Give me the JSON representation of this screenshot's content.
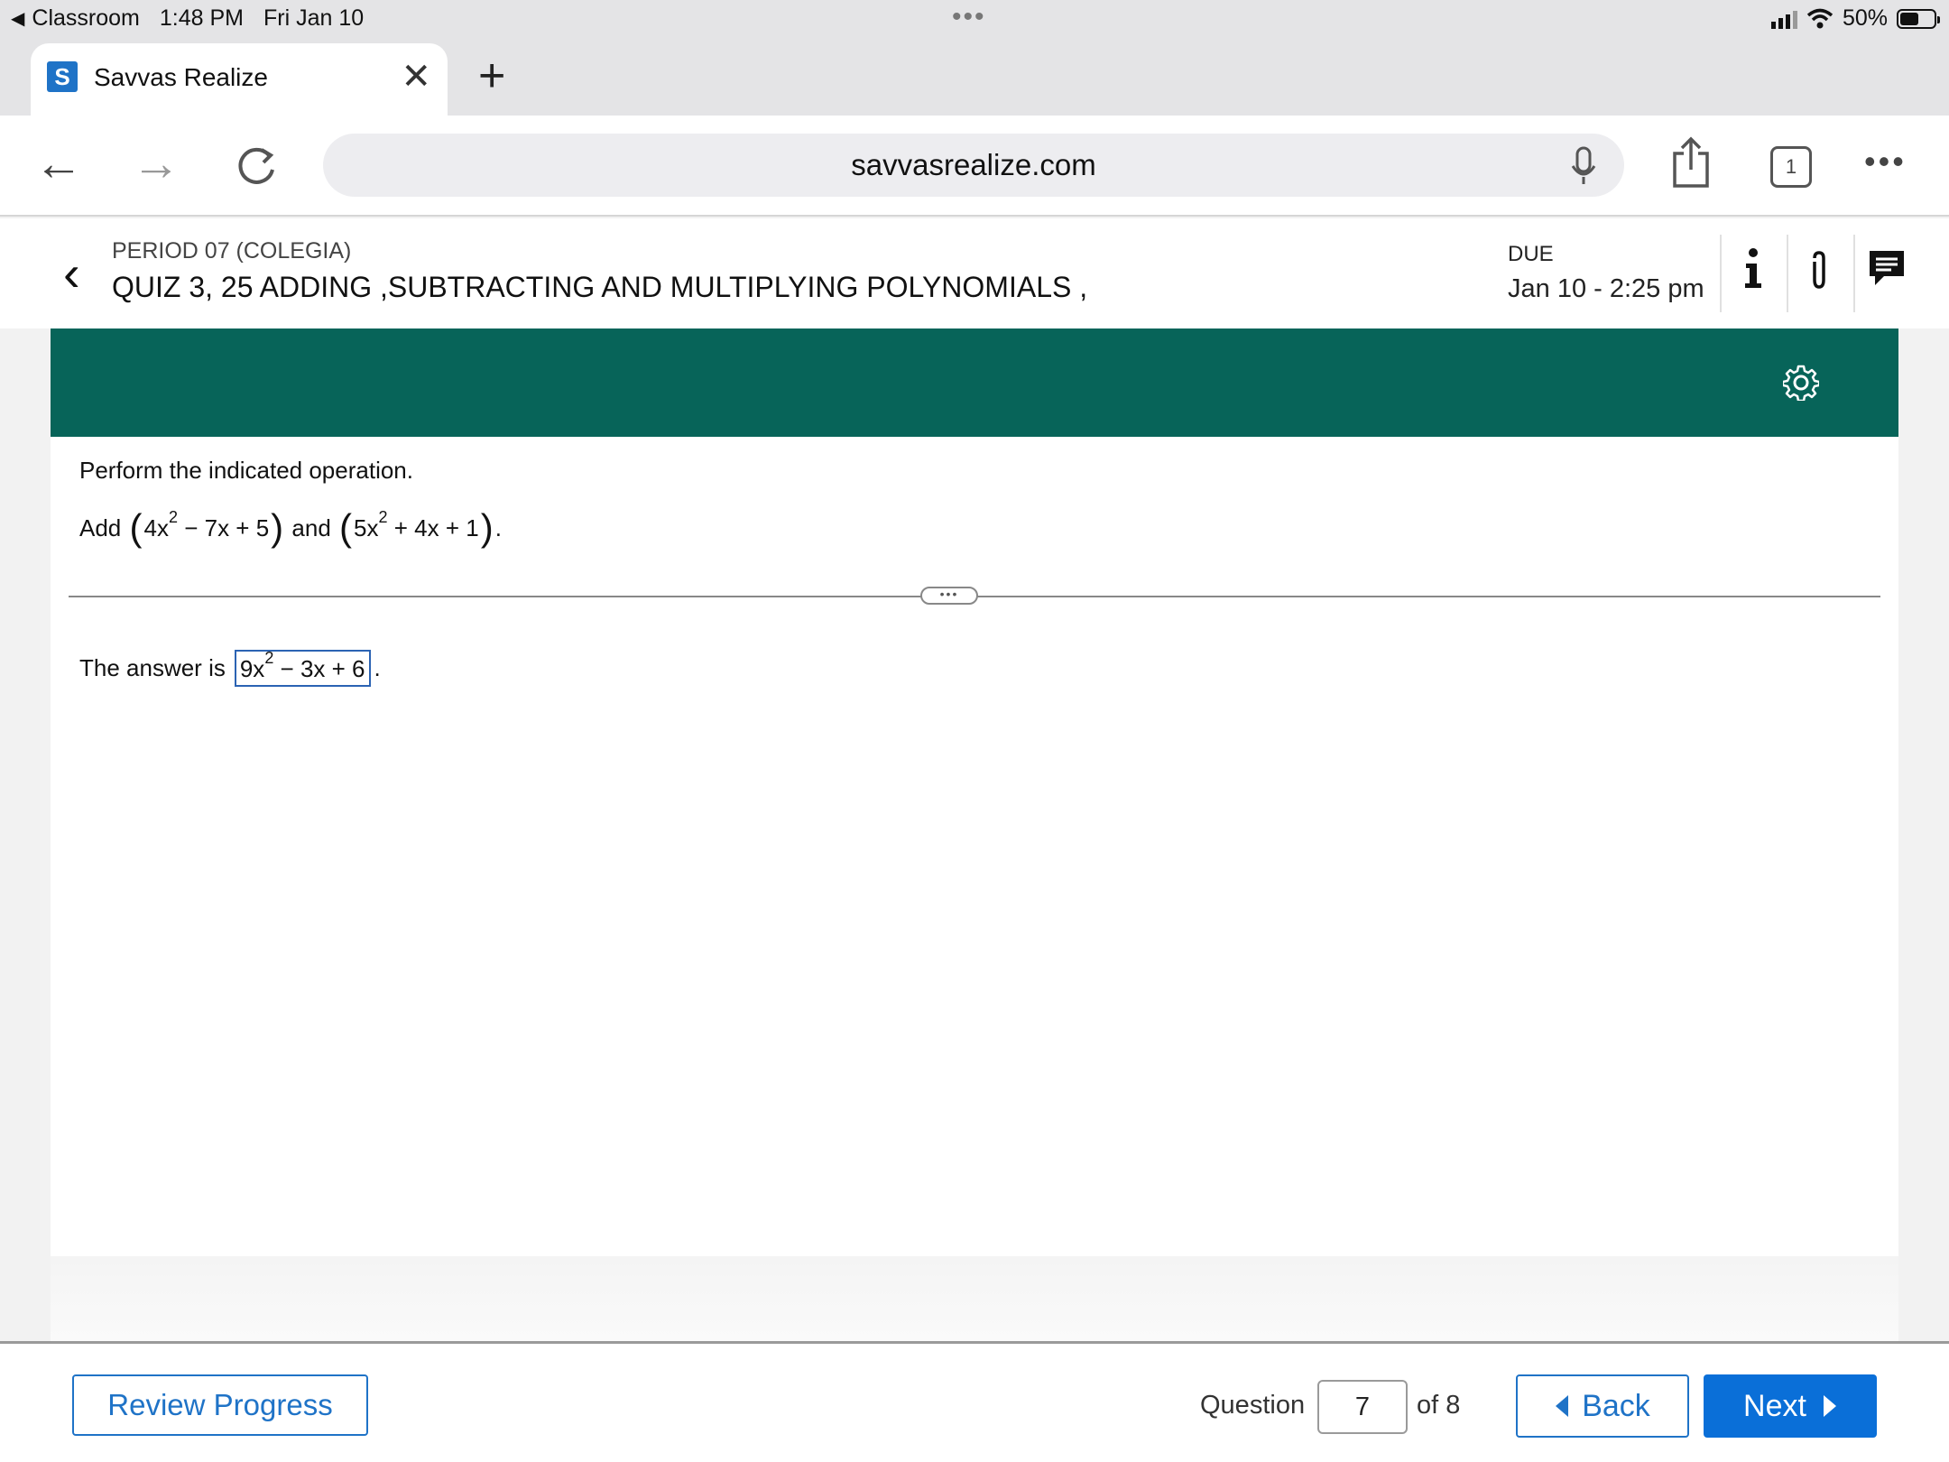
{
  "status": {
    "back_app": "Classroom",
    "time": "1:48 PM",
    "date": "Fri Jan 10",
    "battery": "50%"
  },
  "browser": {
    "tab_title": "Savvas Realize",
    "favicon_letter": "S",
    "url": "savvasrealize.com",
    "tab_count": "1"
  },
  "assignment": {
    "period": "PERIOD 07 (COLEGIA)",
    "title": "QUIZ 3, 25 ADDING ,SUBTRACTING AND MULTIPLYING POLYNOMIALS ,",
    "due_label": "DUE",
    "due_value": "Jan 10 - 2:25 pm"
  },
  "question": {
    "instruction": "Perform the indicated operation.",
    "add_word": "Add",
    "expr1": {
      "a": "4x",
      "exp": "2",
      "rest": " − 7x + 5"
    },
    "and_word": "and",
    "expr2": {
      "a": "5x",
      "exp": "2",
      "rest": " + 4x + 1"
    },
    "end_punct": ".",
    "answer_prefix": "The answer is",
    "answer": {
      "a": "9x",
      "exp": "2",
      "rest": " − 3x + 6"
    },
    "answer_suffix": "."
  },
  "footer": {
    "review_label": "Review Progress",
    "question_label": "Question",
    "question_number": "7",
    "of_label": "of 8",
    "back_label": "Back",
    "next_label": "Next"
  },
  "colors": {
    "teal_banner": "#076459",
    "primary_blue": "#0a6fd8",
    "answer_border": "#2b63b3"
  }
}
